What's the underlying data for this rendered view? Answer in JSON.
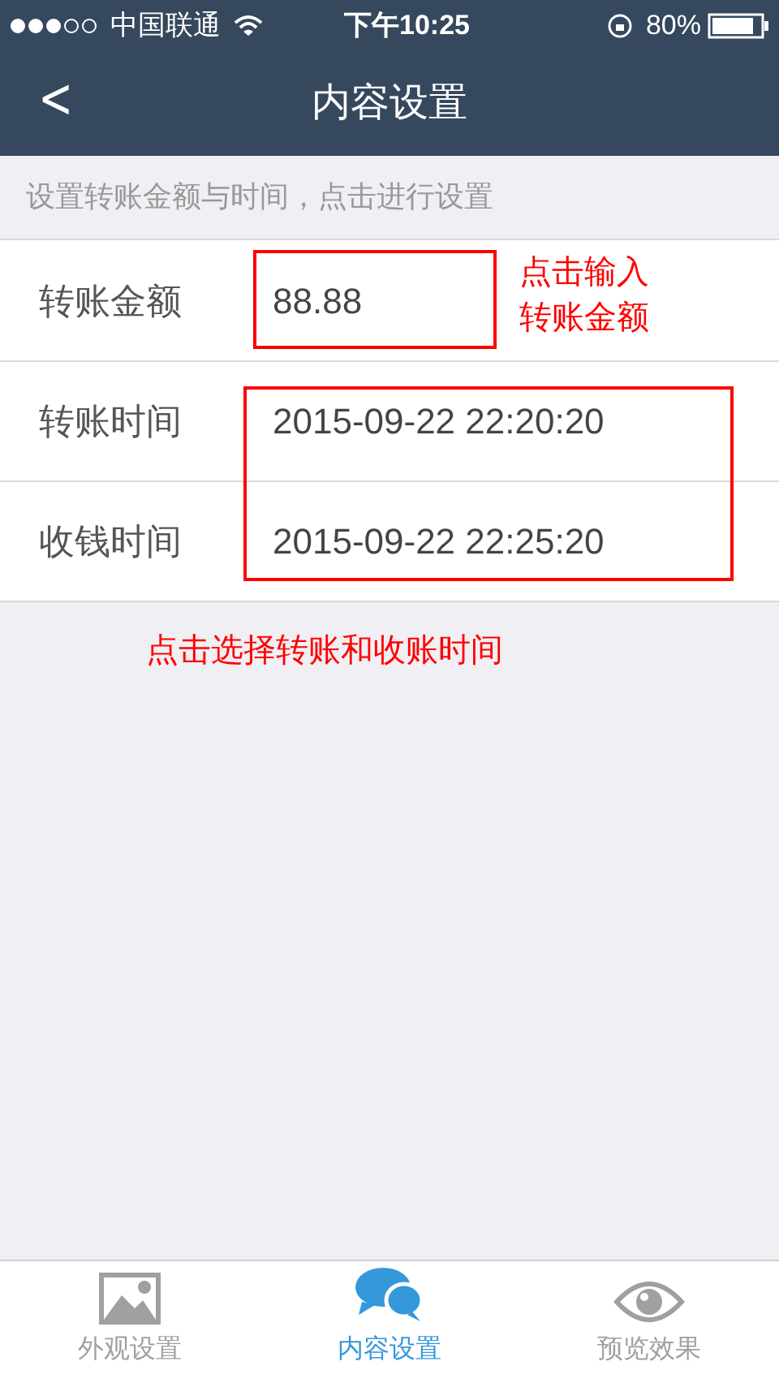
{
  "status_bar": {
    "carrier": "中国联通",
    "time": "下午10:25",
    "battery": "80%"
  },
  "nav": {
    "back": "<",
    "title": "内容设置"
  },
  "hint": "设置转账金额与时间，点击进行设置",
  "fields": [
    {
      "label": "转账金额",
      "value": "88.88"
    },
    {
      "label": "转账时间",
      "value": "2015-09-22 22:20:20"
    },
    {
      "label": "收钱时间",
      "value": "2015-09-22 22:25:20"
    }
  ],
  "annotations": [
    {
      "text": "点击输入转账金额"
    },
    {
      "text": "点击选择转账和收账时间"
    }
  ],
  "tabs": [
    {
      "kind": "picture",
      "label": "外观设置",
      "selected": false
    },
    {
      "kind": "chat",
      "label": "内容设置",
      "selected": true
    },
    {
      "kind": "eye",
      "label": "预览效果",
      "selected": false
    }
  ]
}
